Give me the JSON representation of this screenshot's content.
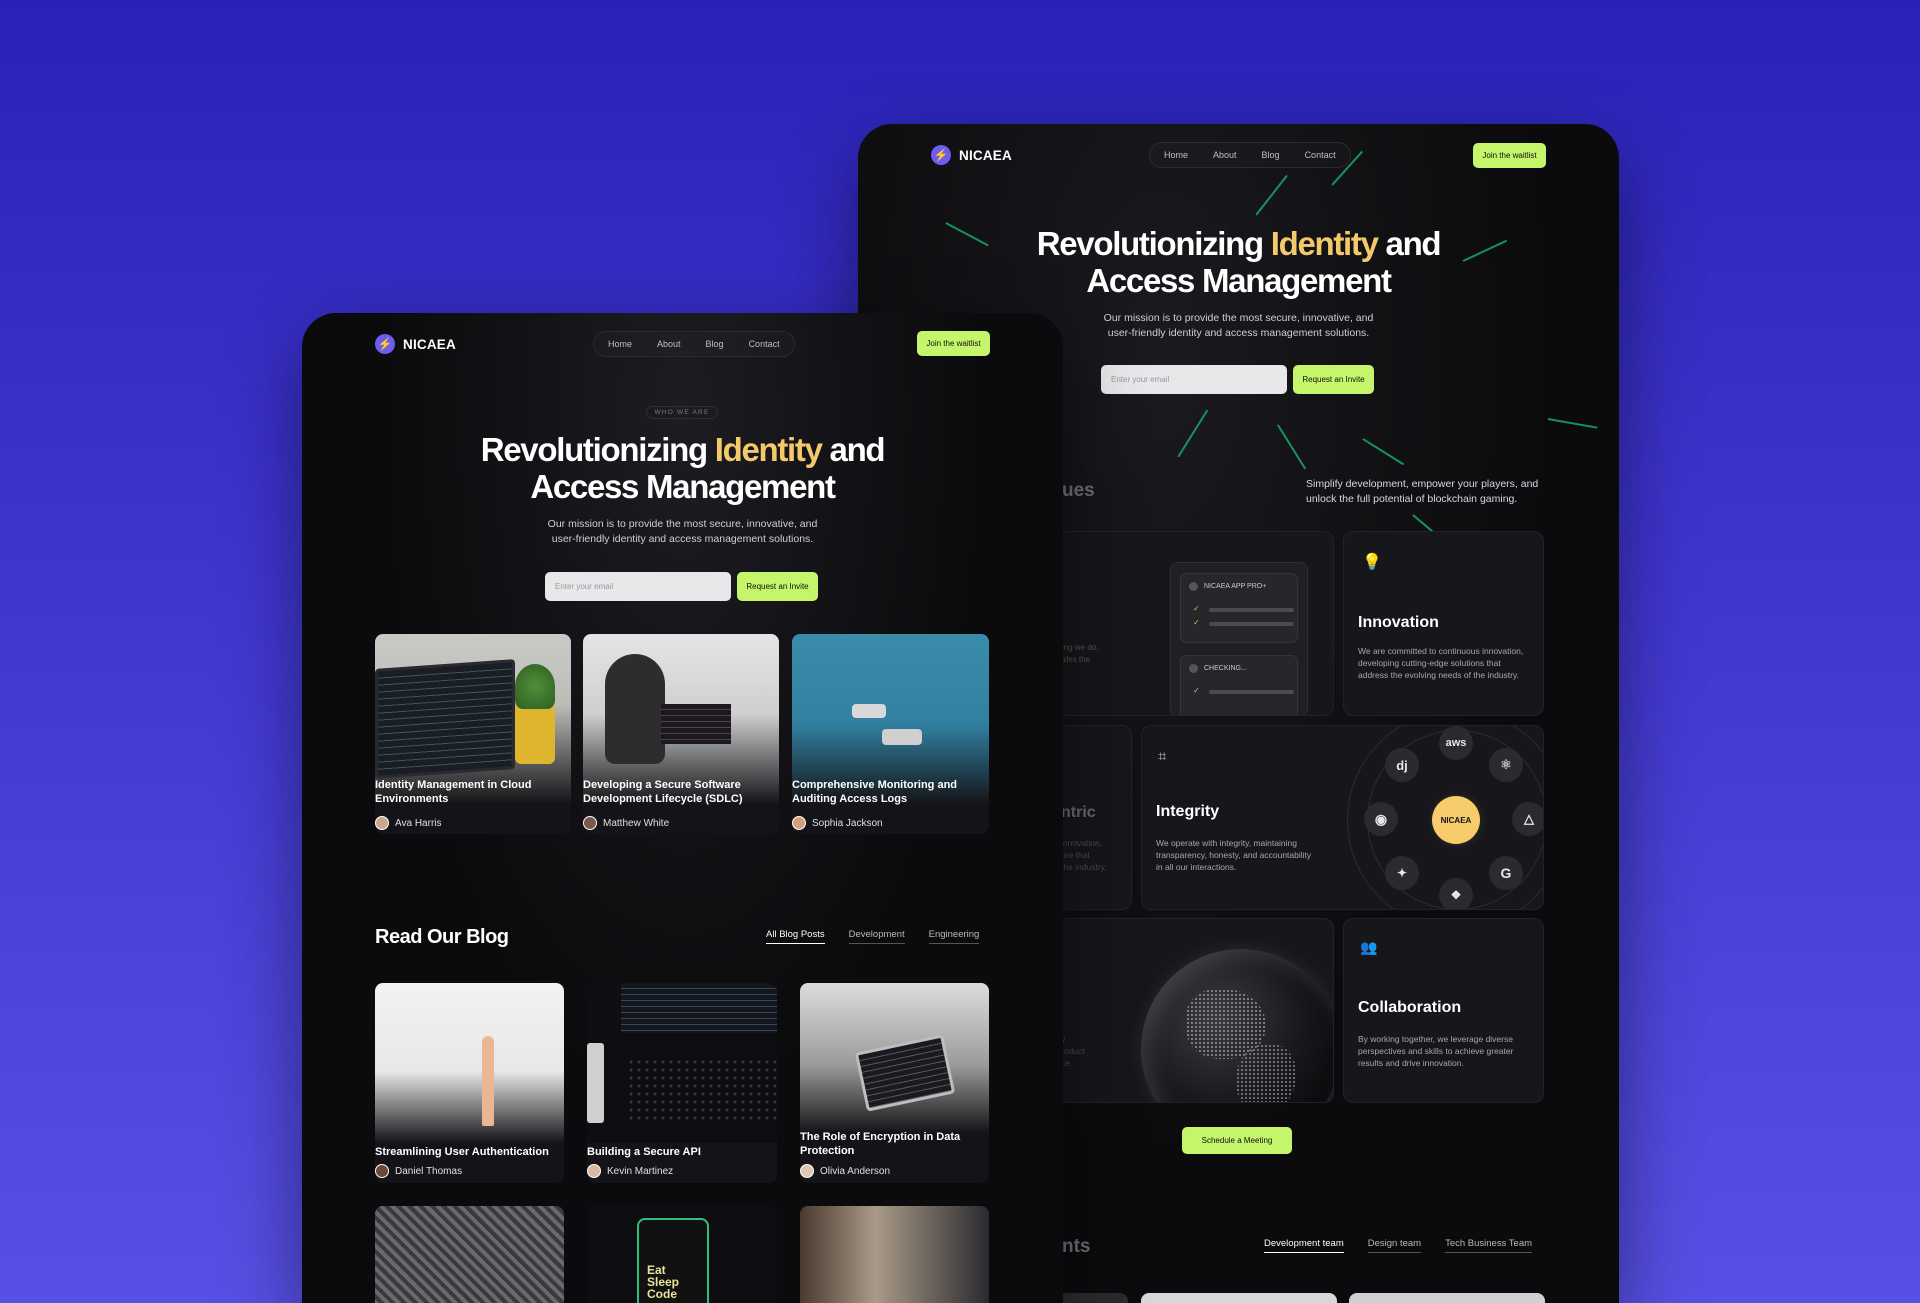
{
  "brand": {
    "name": "NICAEA",
    "logo_icon": "bolt-icon",
    "accent": "#c4f56a",
    "highlight": "#f3c969"
  },
  "nav": {
    "links": [
      "Home",
      "About",
      "Blog",
      "Contact"
    ],
    "cta": "Join the waitlist"
  },
  "hero": {
    "eyebrow": "WHO WE ARE",
    "title_pre": "Revolutionizing ",
    "title_highlight": "Identity",
    "title_post": " and",
    "title_line2": "Access Management",
    "subtitle_line1": "Our mission is to provide the most secure, innovative, and",
    "subtitle_line2": "user-friendly identity and access management solutions.",
    "email_placeholder": "Enter your email",
    "request_button": "Request an Invite"
  },
  "values": {
    "partial_heading": "ues",
    "intro_line1": "Simplify development, empower your players, and",
    "intro_line2": "unlock the full potential of blockchain gaming.",
    "checklist": {
      "title": "NICAEA APP PRO+",
      "checking": "CHECKING..."
    },
    "partial_left_text": [
      "ing we do,",
      "ides the"
    ],
    "innovation": {
      "title": "Innovation",
      "icon": "lightbulb-icon",
      "text": [
        "We are committed to continuous innovation,",
        "developing cutting-edge solutions that",
        "address the evolving needs of the industry."
      ]
    },
    "partial_centric": "ntric",
    "partial_centric_text": [
      "innovation,",
      "ure that",
      "the industry."
    ],
    "integrity": {
      "title": "Integrity",
      "icon": "scan-icon",
      "text": [
        "We operate with integrity, maintaining",
        "transparency, honesty, and accountability",
        "in all our interactions."
      ]
    },
    "orbit": {
      "center": "NICAEA",
      "items": [
        "aws",
        "dj",
        "react-icon",
        "github-icon",
        "nuxt-icon",
        "python-icon",
        "google-icon",
        "figma-icon"
      ],
      "labels": {
        "aws": "aws",
        "dj": "dj",
        "google": "G"
      }
    },
    "partial_bottom_text": [
      "y",
      "roduct",
      "ce."
    ],
    "collaboration": {
      "title": "Collaboration",
      "icon": "users-icon",
      "text": [
        "By working together, we leverage diverse",
        "perspectives and skills to achieve greater",
        "results and drive innovation."
      ]
    },
    "schedule_button": "Schedule a Meeting"
  },
  "team": {
    "partial_heading": "nts",
    "tabs": [
      "Development team",
      "Design team",
      "Tech Business Team"
    ]
  },
  "featured_posts": [
    {
      "title_line1": "Identity Management in Cloud",
      "title_line2": "Environments",
      "author": "Ava Harris"
    },
    {
      "title_line1": "Developing a Secure Software",
      "title_line2": "Development Lifecycle (SDLC)",
      "author": "Matthew White"
    },
    {
      "title_line1": "Comprehensive Monitoring and",
      "title_line2": "Auditing Access Logs",
      "author": "Sophia Jackson"
    }
  ],
  "blog": {
    "heading": "Read Our Blog",
    "tabs": [
      "All Blog Posts",
      "Development",
      "Engineering"
    ],
    "posts": [
      {
        "title_line1": "Streamlining User Authentication",
        "title_line2": "",
        "author": "Daniel Thomas"
      },
      {
        "title_line1": "Building a Secure API",
        "title_line2": "",
        "author": "Kevin Martinez"
      },
      {
        "title_line1": "The Role of Encryption in Data",
        "title_line2": "Protection",
        "author": "Olivia Anderson"
      }
    ],
    "phone_text": [
      "Eat",
      "Sleep",
      "Code"
    ]
  }
}
